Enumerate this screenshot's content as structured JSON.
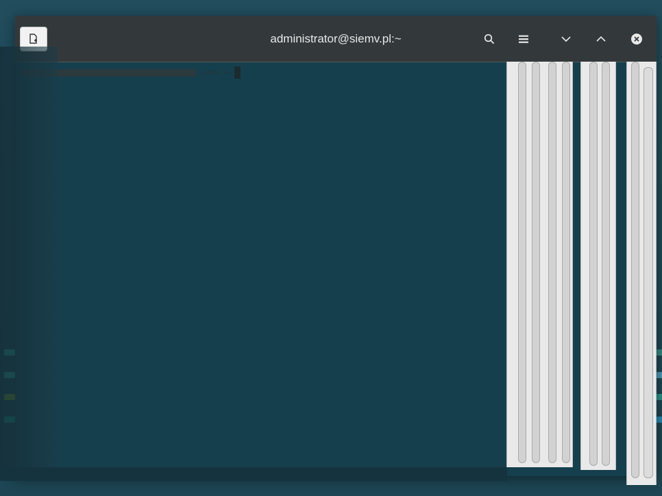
{
  "window": {
    "title": "administrator@siemv.pl:~"
  },
  "toolbar": {
    "new_tab_icon": "new-tab-icon",
    "search_icon": "search-icon",
    "menu_icon": "hamburger-menu-icon",
    "minimize_icon": "chevron-down-icon",
    "maximize_icon": "chevron-up-icon",
    "close_icon": "close-icon"
  },
  "terminal": {
    "prompt_tail": "siemv:~>"
  },
  "colors": {
    "titlebar": "#33393b",
    "terminal_bg": "#163f4d",
    "teal": "#2eb4a0",
    "blue": "#29a3d9",
    "light_blue": "#5cb8e0",
    "white": "#ffffff",
    "olive": "#7fa21f",
    "dark_teal": "#11a289"
  }
}
